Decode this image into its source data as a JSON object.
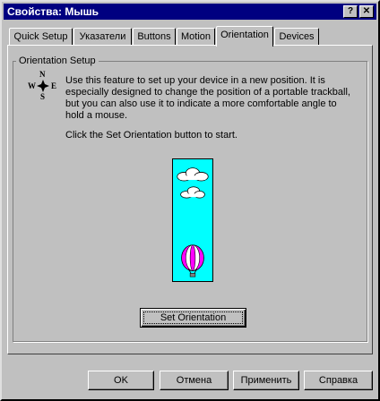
{
  "window": {
    "title": "Свойства: Мышь",
    "help_glyph": "?",
    "close_glyph": "✕"
  },
  "tabs": [
    {
      "label": "Quick Setup"
    },
    {
      "label": "Указатели"
    },
    {
      "label": "Buttons"
    },
    {
      "label": "Motion"
    },
    {
      "label": "Orientation",
      "active": true
    },
    {
      "label": "Devices"
    }
  ],
  "panel": {
    "group_label": "Orientation Setup",
    "compass": {
      "n": "N",
      "w": "W",
      "e": "E",
      "s": "S"
    },
    "description": "Use this feature to set up your device in a new position.  It is especially designed to change the position of a portable trackball, but you can also use it to indicate a more comfortable angle to hold a mouse.",
    "start_text": "Click the Set Orientation button to start.",
    "set_orientation_button": "Set Orientation"
  },
  "footer": {
    "ok": "OK",
    "cancel": "Отмена",
    "apply": "Применить",
    "help": "Справка"
  },
  "colors": {
    "titlebar": "#000080",
    "sky": "#00ffff",
    "balloon_magenta": "#ff00ff"
  },
  "icons": [
    "help-icon",
    "close-icon",
    "compass-icon"
  ]
}
